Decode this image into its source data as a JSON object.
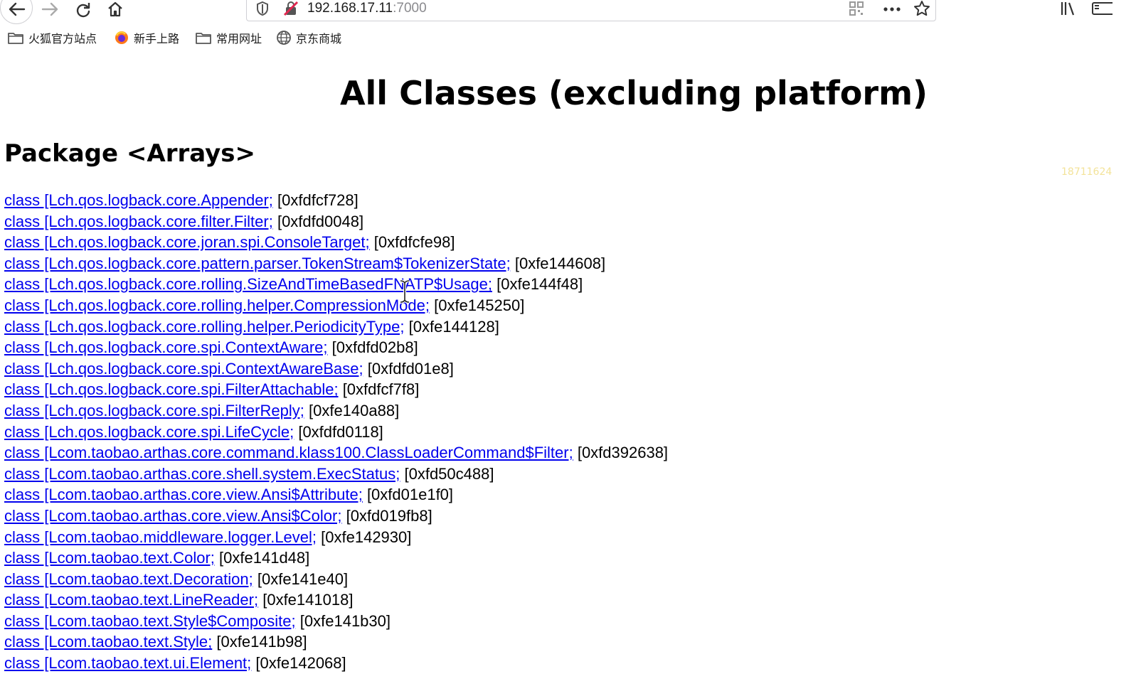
{
  "browser": {
    "url_host": "192.168.17.11",
    "url_port": ":7000",
    "bookmarks": [
      {
        "label": "火狐官方站点",
        "icon": "folder-icon"
      },
      {
        "label": "新手上路",
        "icon": "firefox-icon"
      },
      {
        "label": "常用网址",
        "icon": "folder-icon"
      },
      {
        "label": "京东商城",
        "icon": "globe-icon"
      }
    ]
  },
  "page": {
    "title": "All Classes (excluding platform)",
    "package_heading": "Package <Arrays>",
    "watermark": "18711624",
    "classes": [
      {
        "name": "class [Lch.qos.logback.core.Appender;",
        "address": "[0xfdfcf728]"
      },
      {
        "name": "class [Lch.qos.logback.core.filter.Filter;",
        "address": "[0xfdfd0048]"
      },
      {
        "name": "class [Lch.qos.logback.core.joran.spi.ConsoleTarget;",
        "address": "[0xfdfcfe98]"
      },
      {
        "name": "class [Lch.qos.logback.core.pattern.parser.TokenStream$TokenizerState;",
        "address": "[0xfe144608]"
      },
      {
        "name": "class [Lch.qos.logback.core.rolling.SizeAndTimeBasedFNATP$Usage;",
        "address": "[0xfe144f48]"
      },
      {
        "name": "class [Lch.qos.logback.core.rolling.helper.CompressionMode;",
        "address": "[0xfe145250]"
      },
      {
        "name": "class [Lch.qos.logback.core.rolling.helper.PeriodicityType;",
        "address": "[0xfe144128]"
      },
      {
        "name": "class [Lch.qos.logback.core.spi.ContextAware;",
        "address": "[0xfdfd02b8]"
      },
      {
        "name": "class [Lch.qos.logback.core.spi.ContextAwareBase;",
        "address": "[0xfdfd01e8]"
      },
      {
        "name": "class [Lch.qos.logback.core.spi.FilterAttachable;",
        "address": "[0xfdfcf7f8]"
      },
      {
        "name": "class [Lch.qos.logback.core.spi.FilterReply;",
        "address": "[0xfe140a88]"
      },
      {
        "name": "class [Lch.qos.logback.core.spi.LifeCycle;",
        "address": "[0xfdfd0118]"
      },
      {
        "name": "class [Lcom.taobao.arthas.core.command.klass100.ClassLoaderCommand$Filter;",
        "address": "[0xfd392638]"
      },
      {
        "name": "class [Lcom.taobao.arthas.core.shell.system.ExecStatus;",
        "address": "[0xfd50c488]"
      },
      {
        "name": "class [Lcom.taobao.arthas.core.view.Ansi$Attribute;",
        "address": "[0xfd01e1f0]"
      },
      {
        "name": "class [Lcom.taobao.arthas.core.view.Ansi$Color;",
        "address": "[0xfd019fb8]"
      },
      {
        "name": "class [Lcom.taobao.middleware.logger.Level;",
        "address": "[0xfe142930]"
      },
      {
        "name": "class [Lcom.taobao.text.Color;",
        "address": "[0xfe141d48]"
      },
      {
        "name": "class [Lcom.taobao.text.Decoration;",
        "address": "[0xfe141e40]"
      },
      {
        "name": "class [Lcom.taobao.text.LineReader;",
        "address": "[0xfe141018]"
      },
      {
        "name": "class [Lcom.taobao.text.Style$Composite;",
        "address": "[0xfe141b30]"
      },
      {
        "name": "class [Lcom.taobao.text.Style;",
        "address": "[0xfe141b98]"
      },
      {
        "name": "class [Lcom.taobao.text.ui.Element;",
        "address": "[0xfe142068]"
      }
    ]
  }
}
